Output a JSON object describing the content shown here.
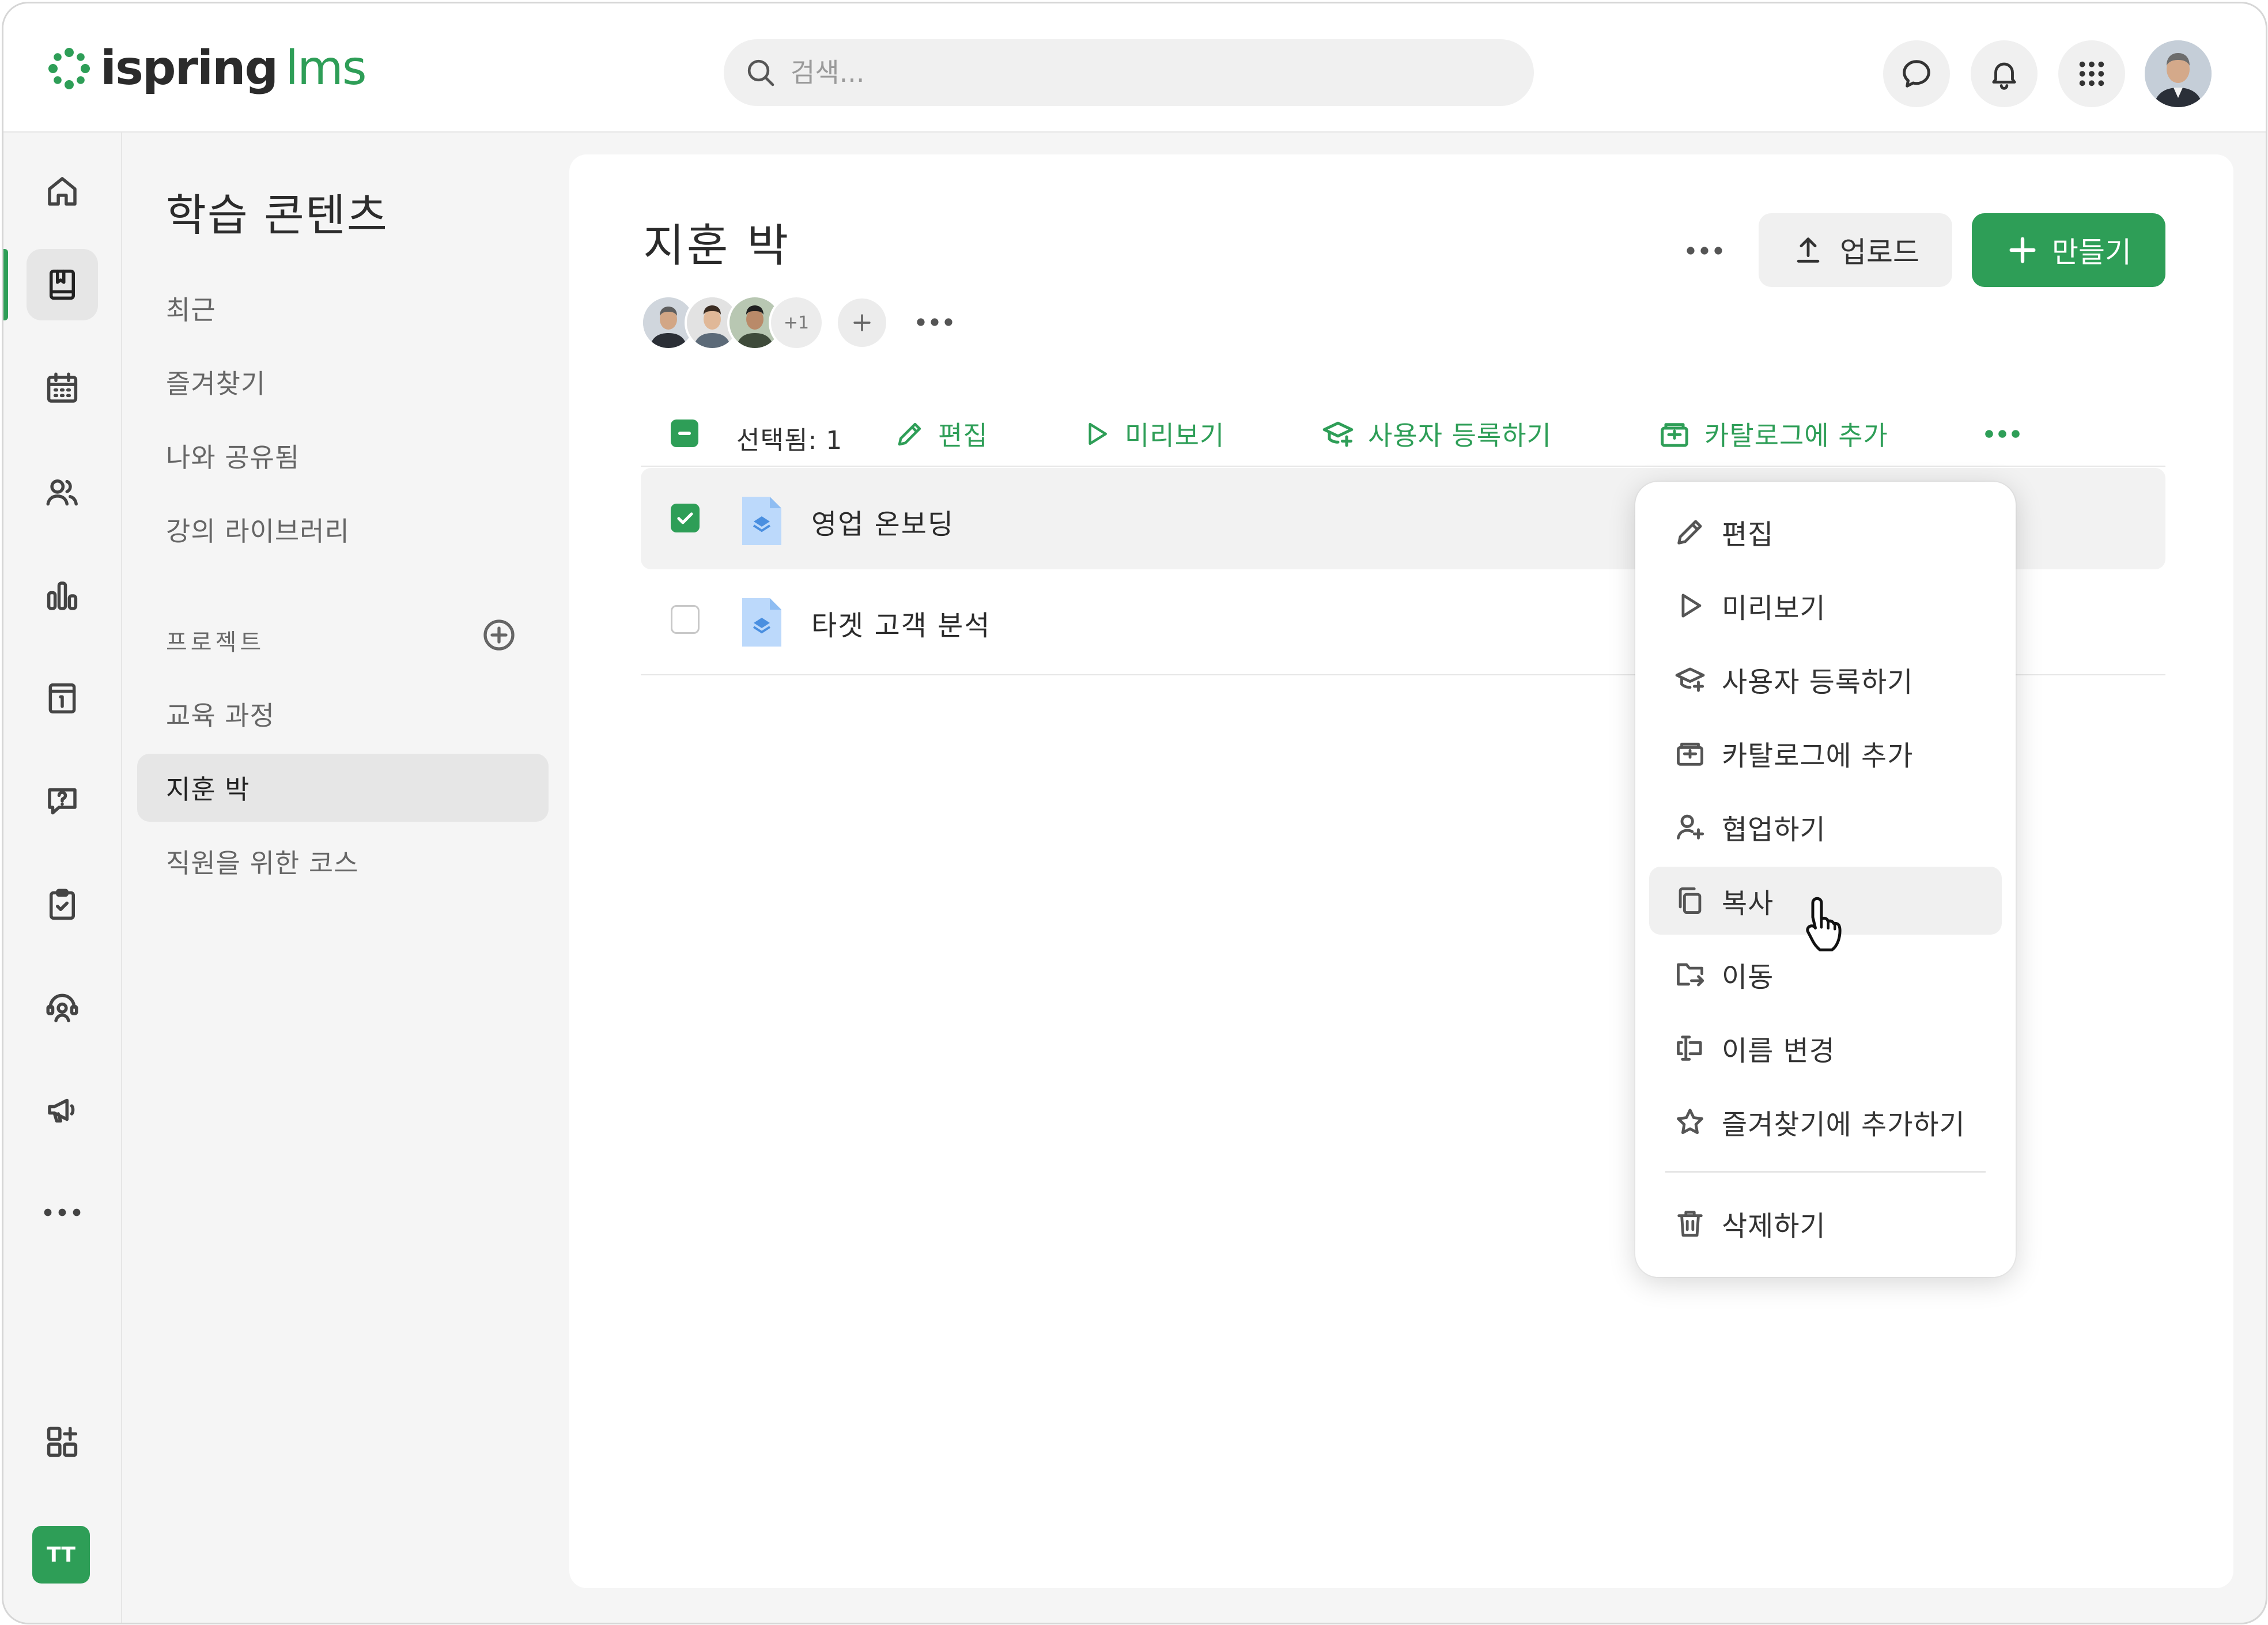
{
  "brand": {
    "logo_main": "ispring",
    "logo_sub": "lms",
    "accent_color": "#2e9e57"
  },
  "search": {
    "placeholder": "검색..."
  },
  "topbar": {
    "icons": [
      "chat-icon",
      "bell-icon",
      "apps-grid-icon",
      "user-avatar"
    ]
  },
  "rail": {
    "items": [
      "home-icon",
      "learning-content-icon",
      "calendar-icon",
      "users-icon",
      "reports-icon",
      "info-icon",
      "help-icon",
      "tasks-icon",
      "support-icon",
      "announcements-icon",
      "more-icon"
    ],
    "active": "learning-content-icon",
    "bottom_icon": "add-apps-icon",
    "user_initials": "TT"
  },
  "sidebar": {
    "title": "학습 콘텐츠",
    "links": [
      "최근",
      "즐겨찾기",
      "나와 공유됨",
      "강의 라이브러리"
    ],
    "section_label": "프로젝트",
    "projects": [
      "교육 과정",
      "지훈 박",
      "직원을 위한 코스"
    ],
    "active_project": "지훈 박"
  },
  "main": {
    "title": "지훈 박",
    "avatars_more": "+1",
    "upload_label": "업로드",
    "create_label": "만들기"
  },
  "toolbar": {
    "selected_label": "선택됨: 1",
    "edit": "편집",
    "preview": "미리보기",
    "enroll": "사용자 등록하기",
    "add_catalog": "카탈로그에 추가"
  },
  "rows": [
    {
      "name": "영업 온보딩",
      "checked": true
    },
    {
      "name": "타겟 고객 분석",
      "checked": false
    }
  ],
  "menu": {
    "edit": "편집",
    "preview": "미리보기",
    "enroll": "사용자 등록하기",
    "add_catalog": "카탈로그에 추가",
    "collaborate": "협업하기",
    "copy": "복사",
    "move": "이동",
    "rename": "이름 변경",
    "favorite": "즐겨찾기에 추가하기",
    "delete": "삭제하기",
    "hovered": "복사"
  }
}
